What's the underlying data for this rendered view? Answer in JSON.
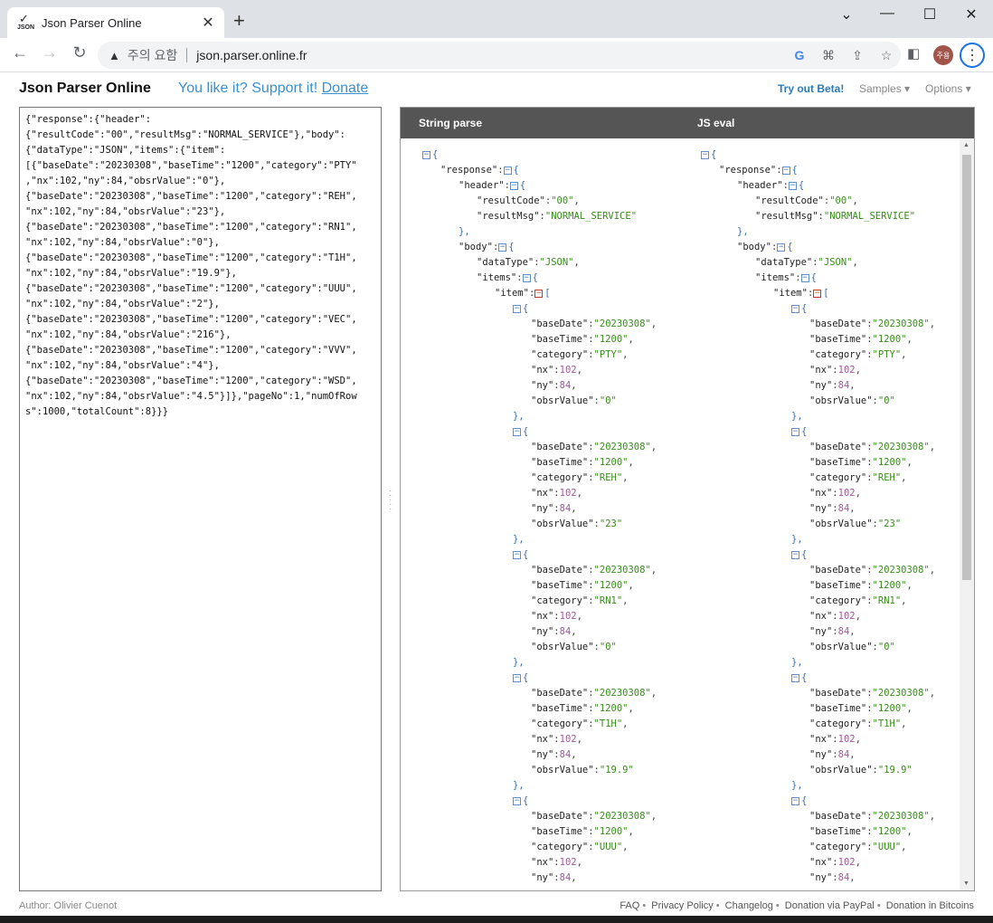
{
  "browser": {
    "tab_title": "Json Parser Online",
    "favicon_label": "JSON",
    "warning_text": "주의 요함",
    "url": "json.parser.online.fr",
    "profile_label": "주용"
  },
  "header": {
    "title": "Json Parser Online",
    "support_text": "You like it? Support it!",
    "donate_label": "Donate",
    "beta_label": "Try out Beta!",
    "samples_label": "Samples ▾",
    "options_label": "Options ▾"
  },
  "editor": {
    "content": "{\"response\":{\"header\":\n{\"resultCode\":\"00\",\"resultMsg\":\"NORMAL_SERVICE\"},\"body\":\n{\"dataType\":\"JSON\",\"items\":{\"item\":\n[{\"baseDate\":\"20230308\",\"baseTime\":\"1200\",\"category\":\"PTY\"\n,\"nx\":102,\"ny\":84,\"obsrValue\":\"0\"},\n{\"baseDate\":\"20230308\",\"baseTime\":\"1200\",\"category\":\"REH\",\n\"nx\":102,\"ny\":84,\"obsrValue\":\"23\"},\n{\"baseDate\":\"20230308\",\"baseTime\":\"1200\",\"category\":\"RN1\",\n\"nx\":102,\"ny\":84,\"obsrValue\":\"0\"},\n{\"baseDate\":\"20230308\",\"baseTime\":\"1200\",\"category\":\"T1H\",\n\"nx\":102,\"ny\":84,\"obsrValue\":\"19.9\"},\n{\"baseDate\":\"20230308\",\"baseTime\":\"1200\",\"category\":\"UUU\",\n\"nx\":102,\"ny\":84,\"obsrValue\":\"2\"},\n{\"baseDate\":\"20230308\",\"baseTime\":\"1200\",\"category\":\"VEC\",\n\"nx\":102,\"ny\":84,\"obsrValue\":\"216\"},\n{\"baseDate\":\"20230308\",\"baseTime\":\"1200\",\"category\":\"VVV\",\n\"nx\":102,\"ny\":84,\"obsrValue\":\"4\"},\n{\"baseDate\":\"20230308\",\"baseTime\":\"1200\",\"category\":\"WSD\",\n\"nx\":102,\"ny\":84,\"obsrValue\":\"4.5\"}]},\"pageNo\":1,\"numOfRow\ns\":1000,\"totalCount\":8}}}"
  },
  "output": {
    "col1_title": "String parse",
    "col2_title": "JS eval",
    "tree": {
      "response_key": "\"response\"",
      "header_key": "\"header\"",
      "resultCode": "\"00\"",
      "resultMsg": "\"NORMAL_SERVICE\"",
      "body_key": "\"body\"",
      "dataType": "\"JSON\"",
      "items_key": "\"items\"",
      "item_key": "\"item\"",
      "records": [
        {
          "baseDate": "\"20230308\"",
          "baseTime": "\"1200\"",
          "category": "\"PTY\"",
          "nx": "102",
          "ny": "84",
          "obsrValue": "\"0\""
        },
        {
          "baseDate": "\"20230308\"",
          "baseTime": "\"1200\"",
          "category": "\"REH\"",
          "nx": "102",
          "ny": "84",
          "obsrValue": "\"23\""
        },
        {
          "baseDate": "\"20230308\"",
          "baseTime": "\"1200\"",
          "category": "\"RN1\"",
          "nx": "102",
          "ny": "84",
          "obsrValue": "\"0\""
        },
        {
          "baseDate": "\"20230308\"",
          "baseTime": "\"1200\"",
          "category": "\"T1H\"",
          "nx": "102",
          "ny": "84",
          "obsrValue": "\"19.9\""
        },
        {
          "baseDate": "\"20230308\"",
          "baseTime": "\"1200\"",
          "category": "\"UUU\"",
          "nx": "102",
          "ny": "84"
        }
      ]
    }
  },
  "footer": {
    "author": "Author: Olivier Cuenot",
    "links": [
      "FAQ",
      "Privacy Policy",
      "Changelog",
      "Donation via PayPal",
      "Donation in Bitcoins"
    ]
  }
}
